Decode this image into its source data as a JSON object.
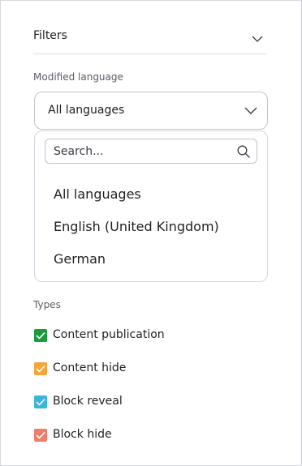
{
  "filters": {
    "title": "Filters",
    "chevron_icon": "chevron-down-icon"
  },
  "modified_language": {
    "label": "Modified language",
    "selected": "All languages",
    "search_placeholder": "Search...",
    "search_icon": "search-icon",
    "options": [
      "All languages",
      "English (United Kingdom)",
      "German"
    ]
  },
  "types": {
    "label": "Types",
    "items": [
      {
        "label": "Content publication",
        "color": "#1a9b3c",
        "checked": true
      },
      {
        "label": "Content hide",
        "color": "#f5a53a",
        "checked": true
      },
      {
        "label": "Block reveal",
        "color": "#3db4dc",
        "checked": true
      },
      {
        "label": "Block hide",
        "color": "#ef7d6b",
        "checked": true
      }
    ]
  }
}
